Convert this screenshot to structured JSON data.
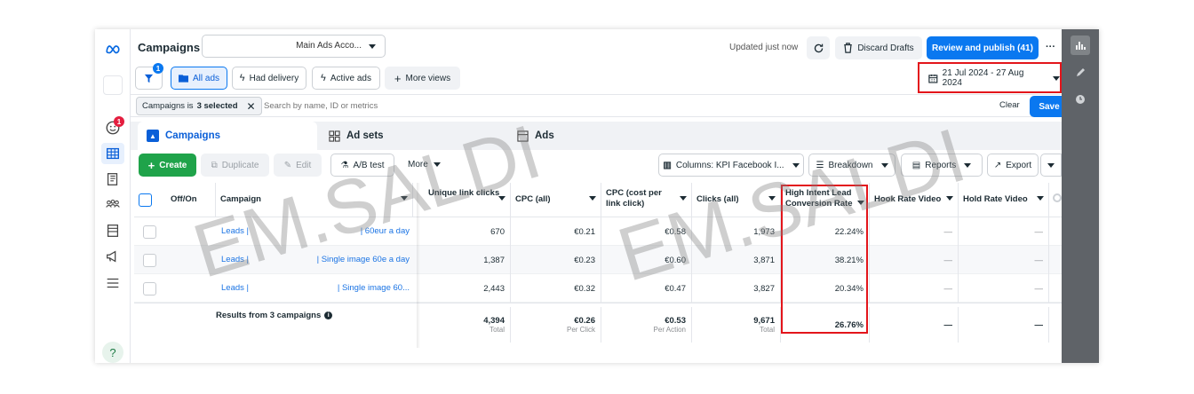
{
  "header": {
    "title": "Campaigns",
    "account": "Main Ads Acco...",
    "updated": "Updated just now",
    "discard": "Discard Drafts",
    "review": "Review and publish (41)",
    "more": "···"
  },
  "filters": {
    "badge": "1",
    "all_ads": "All ads",
    "had_delivery": "Had delivery",
    "active_ads": "Active ads",
    "more_views": "More views",
    "date_range": "21 Jul 2024 - 27 Aug 2024"
  },
  "search": {
    "chip_prefix": "Campaigns is",
    "chip_value": "3 selected",
    "placeholder": "Search by name, ID or metrics",
    "clear": "Clear",
    "save": "Save"
  },
  "nav": {
    "notif_badge": "1",
    "help": "?"
  },
  "tabs": [
    {
      "label": "Campaigns",
      "active": true
    },
    {
      "label": "Ad sets",
      "active": false
    },
    {
      "label": "Ads",
      "active": false
    }
  ],
  "actions": {
    "create": "Create",
    "duplicate": "Duplicate",
    "edit": "Edit",
    "ab_test": "A/B test",
    "more": "More",
    "columns": "Columns: KPI Facebook I...",
    "breakdown": "Breakdown",
    "reports": "Reports",
    "export": "Export"
  },
  "table": {
    "columns": [
      "Off/On",
      "Campaign",
      "Unique link clicks",
      "CPC (all)",
      "CPC (cost per link click)",
      "Clicks (all)",
      "High Intent Lead Conversion Rate",
      "Hook Rate Video",
      "Hold Rate Video"
    ],
    "rows": [
      {
        "campaign_a": "Leads |",
        "campaign_b": "| 60eur a day",
        "unique_clicks": "670",
        "cpc_all": "€0.21",
        "cpc_link": "€0.58",
        "clicks": "1,973",
        "hilcr": "22.24%",
        "hook": "—",
        "hold": "—"
      },
      {
        "campaign_a": "Leads |",
        "campaign_b": "| Single image 60e a day",
        "unique_clicks": "1,387",
        "cpc_all": "€0.23",
        "cpc_link": "€0.60",
        "clicks": "3,871",
        "hilcr": "38.21%",
        "hook": "—",
        "hold": "—"
      },
      {
        "campaign_a": "Leads |",
        "campaign_b": "| Single image 60...",
        "unique_clicks": "2,443",
        "cpc_all": "€0.32",
        "cpc_link": "€0.47",
        "clicks": "3,827",
        "hilcr": "20.34%",
        "hook": "—",
        "hold": "—"
      }
    ],
    "totals": {
      "label": "Results from 3 campaigns",
      "unique_clicks": "4,394",
      "unique_clicks_sub": "Total",
      "cpc_all": "€0.26",
      "cpc_all_sub": "Per Click",
      "cpc_link": "€0.53",
      "cpc_link_sub": "Per Action",
      "clicks": "9,671",
      "clicks_sub": "Total",
      "hilcr": "26.76%",
      "hook": "—",
      "hold": "—"
    }
  },
  "watermark": [
    "EM.SALDI",
    "EM.SALDI"
  ],
  "colors": {
    "accent": "#0a78f0",
    "create": "#1fa34a",
    "highlight": "#e3151b"
  }
}
